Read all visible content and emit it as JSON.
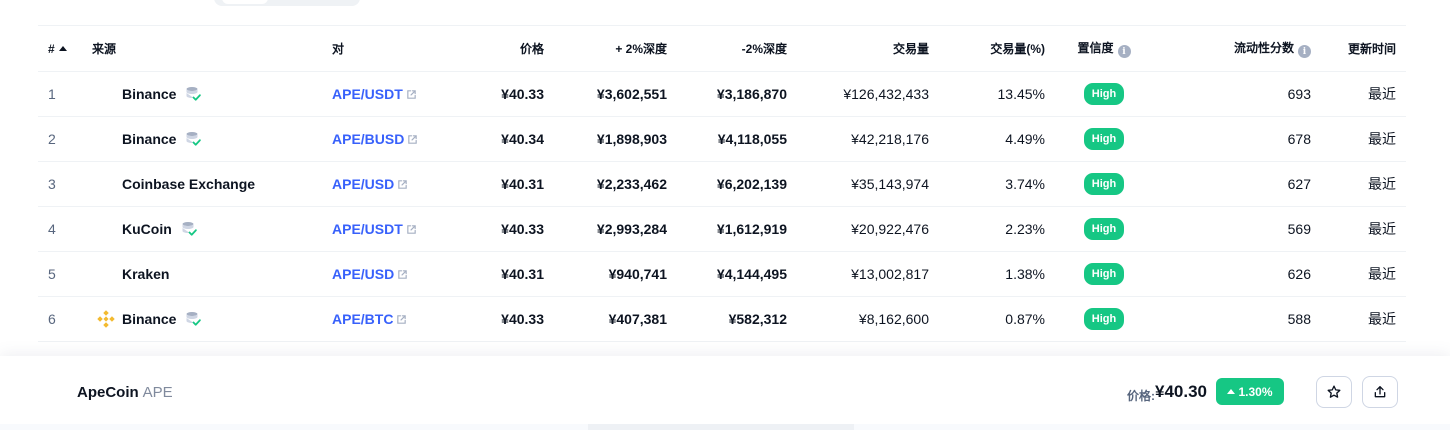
{
  "table": {
    "headers": {
      "num": "#",
      "source": "来源",
      "pair": "对",
      "price": "价格",
      "depth_plus": "+ 2%深度",
      "depth_minus": "-2%深度",
      "volume": "交易量",
      "volume_pct": "交易量(%)",
      "confidence": "置信度",
      "liquidity": "流动性分数",
      "updated": "更新时间"
    },
    "rows": [
      {
        "num": "1",
        "source": "Binance",
        "verified": true,
        "logo": "",
        "pair": "APE/USDT",
        "price": "¥40.33",
        "depth_plus": "¥3,602,551",
        "depth_minus": "¥3,186,870",
        "volume": "¥126,432,433",
        "volume_pct": "13.45%",
        "confidence": "High",
        "liquidity": "693",
        "updated": "最近"
      },
      {
        "num": "2",
        "source": "Binance",
        "verified": true,
        "logo": "",
        "pair": "APE/BUSD",
        "price": "¥40.34",
        "depth_plus": "¥1,898,903",
        "depth_minus": "¥4,118,055",
        "volume": "¥42,218,176",
        "volume_pct": "4.49%",
        "confidence": "High",
        "liquidity": "678",
        "updated": "最近"
      },
      {
        "num": "3",
        "source": "Coinbase Exchange",
        "verified": false,
        "logo": "",
        "pair": "APE/USD",
        "price": "¥40.31",
        "depth_plus": "¥2,233,462",
        "depth_minus": "¥6,202,139",
        "volume": "¥35,143,974",
        "volume_pct": "3.74%",
        "confidence": "High",
        "liquidity": "627",
        "updated": "最近"
      },
      {
        "num": "4",
        "source": "KuCoin",
        "verified": true,
        "logo": "",
        "pair": "APE/USDT",
        "price": "¥40.33",
        "depth_plus": "¥2,993,284",
        "depth_minus": "¥1,612,919",
        "volume": "¥20,922,476",
        "volume_pct": "2.23%",
        "confidence": "High",
        "liquidity": "569",
        "updated": "最近"
      },
      {
        "num": "5",
        "source": "Kraken",
        "verified": false,
        "logo": "",
        "pair": "APE/USD",
        "price": "¥40.31",
        "depth_plus": "¥940,741",
        "depth_minus": "¥4,144,495",
        "volume": "¥13,002,817",
        "volume_pct": "1.38%",
        "confidence": "High",
        "liquidity": "626",
        "updated": "最近"
      },
      {
        "num": "6",
        "source": "Binance",
        "verified": true,
        "logo": "binance-logo",
        "pair": "APE/BTC",
        "price": "¥40.33",
        "depth_plus": "¥407,381",
        "depth_minus": "¥582,312",
        "volume": "¥8,162,600",
        "volume_pct": "0.87%",
        "confidence": "High",
        "liquidity": "588",
        "updated": "最近"
      }
    ]
  },
  "footer": {
    "coin_name": "ApeCoin",
    "coin_symbol": "APE",
    "price_label": "价格:",
    "price": "¥40.30",
    "change": "1.30%",
    "star_icon": "star-icon",
    "share_icon": "share-icon"
  },
  "colors": {
    "link": "#3861fb",
    "positive": "#16c784",
    "text": "#0d1421",
    "muted": "#58667e",
    "binance": "#f3ba2f"
  }
}
